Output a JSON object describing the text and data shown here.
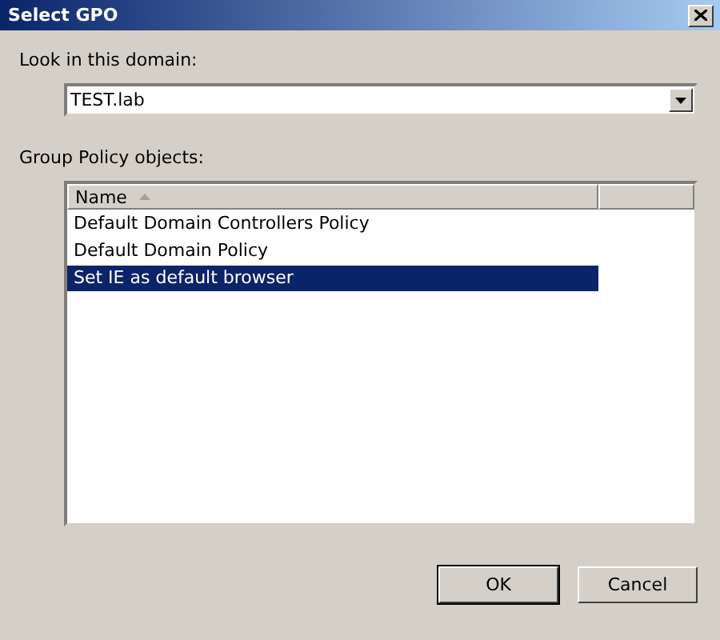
{
  "window": {
    "title": "Select GPO"
  },
  "domain": {
    "label": "Look in this domain:",
    "value": "TEST.lab"
  },
  "gpo_list": {
    "label": "Group Policy objects:",
    "columns": [
      {
        "label": "Name",
        "sorted": true
      },
      {
        "sorted": false
      }
    ],
    "rows": [
      {
        "name": "Default Domain Controllers Policy",
        "selected": false
      },
      {
        "name": "Default Domain Policy",
        "selected": false
      },
      {
        "name": "Set IE as default browser",
        "selected": true
      }
    ]
  },
  "buttons": [
    {
      "label": "OK",
      "default": true
    },
    {
      "label": "Cancel",
      "default": false
    }
  ]
}
